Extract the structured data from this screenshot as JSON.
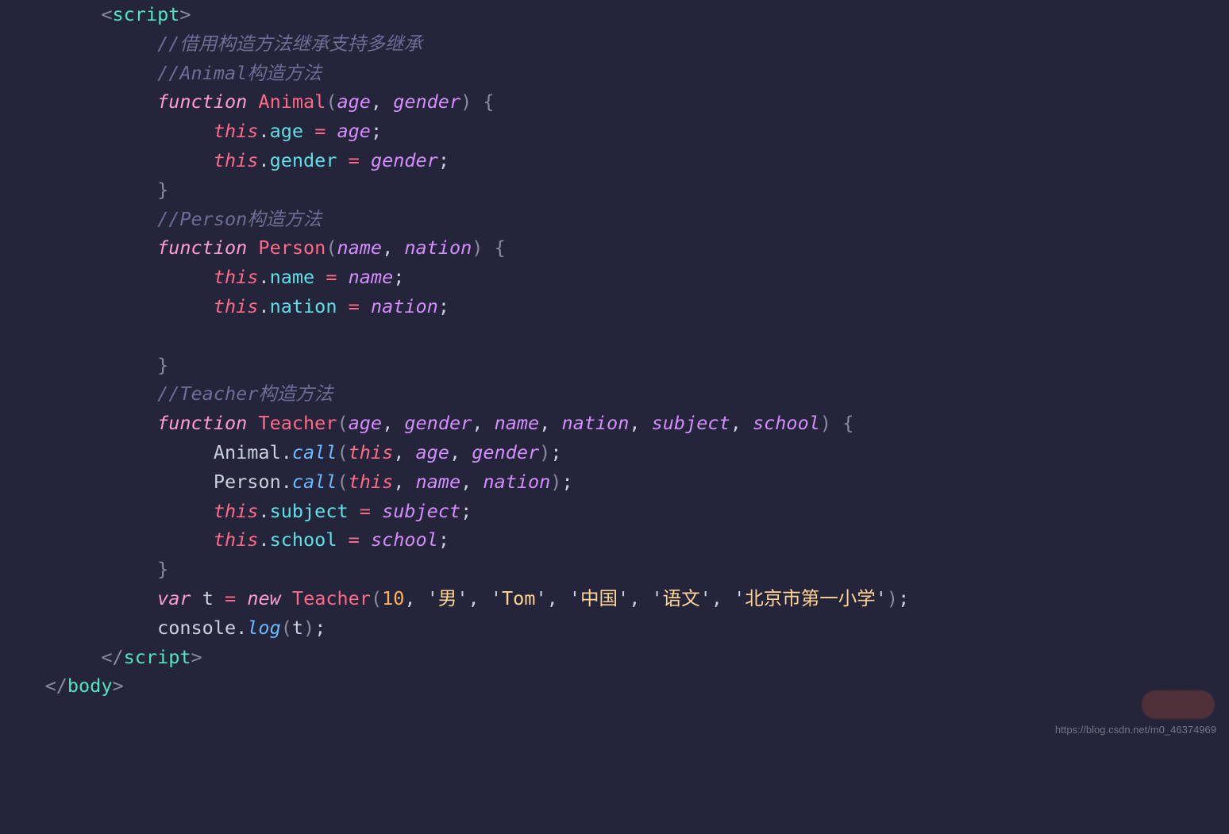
{
  "attribution": "https://blog.csdn.net/m0_46374969",
  "code": {
    "lines": [
      {
        "indent": 2,
        "tokens": [
          {
            "c": "br",
            "t": "<"
          },
          {
            "c": "tag",
            "t": "script"
          },
          {
            "c": "br",
            "t": ">"
          }
        ]
      },
      {
        "indent": 4,
        "tokens": [
          {
            "c": "com",
            "t": "//借用构造方法继承支持多继承"
          }
        ]
      },
      {
        "indent": 4,
        "tokens": [
          {
            "c": "com",
            "t": "//Animal构造方法"
          }
        ]
      },
      {
        "indent": 4,
        "tokens": [
          {
            "c": "kw",
            "t": "function"
          },
          {
            "c": "pun",
            "t": " "
          },
          {
            "c": "def",
            "t": "Animal"
          },
          {
            "c": "br",
            "t": "("
          },
          {
            "c": "par",
            "t": "age"
          },
          {
            "c": "pun",
            "t": ", "
          },
          {
            "c": "par",
            "t": "gender"
          },
          {
            "c": "br",
            "t": ")"
          },
          {
            "c": "pun",
            "t": " "
          },
          {
            "c": "br",
            "t": "{"
          }
        ]
      },
      {
        "indent": 6,
        "tokens": [
          {
            "c": "this",
            "t": "this"
          },
          {
            "c": "pun",
            "t": "."
          },
          {
            "c": "prop",
            "t": "age"
          },
          {
            "c": "pun",
            "t": " "
          },
          {
            "c": "ass",
            "t": "="
          },
          {
            "c": "pun",
            "t": " "
          },
          {
            "c": "par",
            "t": "age"
          },
          {
            "c": "pun",
            "t": ";"
          }
        ]
      },
      {
        "indent": 6,
        "tokens": [
          {
            "c": "this",
            "t": "this"
          },
          {
            "c": "pun",
            "t": "."
          },
          {
            "c": "prop",
            "t": "gender"
          },
          {
            "c": "pun",
            "t": " "
          },
          {
            "c": "ass",
            "t": "="
          },
          {
            "c": "pun",
            "t": " "
          },
          {
            "c": "par",
            "t": "gender"
          },
          {
            "c": "pun",
            "t": ";"
          }
        ]
      },
      {
        "indent": 4,
        "tokens": [
          {
            "c": "br",
            "t": "}"
          }
        ]
      },
      {
        "indent": 4,
        "tokens": [
          {
            "c": "com",
            "t": "//Person构造方法"
          }
        ]
      },
      {
        "indent": 4,
        "tokens": [
          {
            "c": "kw",
            "t": "function"
          },
          {
            "c": "pun",
            "t": " "
          },
          {
            "c": "def",
            "t": "Person"
          },
          {
            "c": "br",
            "t": "("
          },
          {
            "c": "par",
            "t": "name"
          },
          {
            "c": "pun",
            "t": ", "
          },
          {
            "c": "par",
            "t": "nation"
          },
          {
            "c": "br",
            "t": ")"
          },
          {
            "c": "pun",
            "t": " "
          },
          {
            "c": "br",
            "t": "{"
          }
        ]
      },
      {
        "indent": 6,
        "tokens": [
          {
            "c": "this",
            "t": "this"
          },
          {
            "c": "pun",
            "t": "."
          },
          {
            "c": "prop",
            "t": "name"
          },
          {
            "c": "pun",
            "t": " "
          },
          {
            "c": "ass",
            "t": "="
          },
          {
            "c": "pun",
            "t": " "
          },
          {
            "c": "par",
            "t": "name"
          },
          {
            "c": "pun",
            "t": ";"
          }
        ]
      },
      {
        "indent": 6,
        "tokens": [
          {
            "c": "this",
            "t": "this"
          },
          {
            "c": "pun",
            "t": "."
          },
          {
            "c": "prop",
            "t": "nation"
          },
          {
            "c": "pun",
            "t": " "
          },
          {
            "c": "ass",
            "t": "="
          },
          {
            "c": "pun",
            "t": " "
          },
          {
            "c": "par",
            "t": "nation"
          },
          {
            "c": "pun",
            "t": ";"
          }
        ]
      },
      {
        "indent": 6,
        "tokens": [
          {
            "c": "pun",
            "t": ""
          }
        ]
      },
      {
        "indent": 4,
        "tokens": [
          {
            "c": "br",
            "t": "}"
          }
        ]
      },
      {
        "indent": 4,
        "tokens": [
          {
            "c": "com",
            "t": "//Teacher构造方法"
          }
        ]
      },
      {
        "indent": 4,
        "tokens": [
          {
            "c": "kw",
            "t": "function"
          },
          {
            "c": "pun",
            "t": " "
          },
          {
            "c": "def",
            "t": "Teacher"
          },
          {
            "c": "br",
            "t": "("
          },
          {
            "c": "par",
            "t": "age"
          },
          {
            "c": "pun",
            "t": ", "
          },
          {
            "c": "par",
            "t": "gender"
          },
          {
            "c": "pun",
            "t": ", "
          },
          {
            "c": "par",
            "t": "name"
          },
          {
            "c": "pun",
            "t": ", "
          },
          {
            "c": "par",
            "t": "nation"
          },
          {
            "c": "pun",
            "t": ", "
          },
          {
            "c": "par",
            "t": "subject"
          },
          {
            "c": "pun",
            "t": ", "
          },
          {
            "c": "par",
            "t": "school"
          },
          {
            "c": "br",
            "t": ")"
          },
          {
            "c": "pun",
            "t": " "
          },
          {
            "c": "br",
            "t": "{"
          }
        ]
      },
      {
        "indent": 6,
        "tokens": [
          {
            "c": "id",
            "t": "Animal"
          },
          {
            "c": "pun",
            "t": "."
          },
          {
            "c": "call",
            "t": "call"
          },
          {
            "c": "br",
            "t": "("
          },
          {
            "c": "this",
            "t": "this"
          },
          {
            "c": "pun",
            "t": ", "
          },
          {
            "c": "par",
            "t": "age"
          },
          {
            "c": "pun",
            "t": ", "
          },
          {
            "c": "par",
            "t": "gender"
          },
          {
            "c": "br",
            "t": ")"
          },
          {
            "c": "pun",
            "t": ";"
          }
        ]
      },
      {
        "indent": 6,
        "tokens": [
          {
            "c": "id",
            "t": "Person"
          },
          {
            "c": "pun",
            "t": "."
          },
          {
            "c": "call",
            "t": "call"
          },
          {
            "c": "br",
            "t": "("
          },
          {
            "c": "this",
            "t": "this"
          },
          {
            "c": "pun",
            "t": ", "
          },
          {
            "c": "par",
            "t": "name"
          },
          {
            "c": "pun",
            "t": ", "
          },
          {
            "c": "par",
            "t": "nation"
          },
          {
            "c": "br",
            "t": ")"
          },
          {
            "c": "pun",
            "t": ";"
          }
        ]
      },
      {
        "indent": 6,
        "tokens": [
          {
            "c": "this",
            "t": "this"
          },
          {
            "c": "pun",
            "t": "."
          },
          {
            "c": "prop",
            "t": "subject"
          },
          {
            "c": "pun",
            "t": " "
          },
          {
            "c": "ass",
            "t": "="
          },
          {
            "c": "pun",
            "t": " "
          },
          {
            "c": "par",
            "t": "subject"
          },
          {
            "c": "pun",
            "t": ";"
          }
        ]
      },
      {
        "indent": 6,
        "tokens": [
          {
            "c": "this",
            "t": "this"
          },
          {
            "c": "pun",
            "t": "."
          },
          {
            "c": "prop",
            "t": "school"
          },
          {
            "c": "pun",
            "t": " "
          },
          {
            "c": "ass",
            "t": "="
          },
          {
            "c": "pun",
            "t": " "
          },
          {
            "c": "par",
            "t": "school"
          },
          {
            "c": "pun",
            "t": ";"
          }
        ]
      },
      {
        "indent": 4,
        "tokens": [
          {
            "c": "br",
            "t": "}"
          }
        ]
      },
      {
        "indent": 4,
        "tokens": [
          {
            "c": "kw",
            "t": "var"
          },
          {
            "c": "pun",
            "t": " "
          },
          {
            "c": "id",
            "t": "t"
          },
          {
            "c": "pun",
            "t": " "
          },
          {
            "c": "ass",
            "t": "="
          },
          {
            "c": "pun",
            "t": " "
          },
          {
            "c": "kw",
            "t": "new"
          },
          {
            "c": "pun",
            "t": " "
          },
          {
            "c": "def",
            "t": "Teacher"
          },
          {
            "c": "br",
            "t": "("
          },
          {
            "c": "num",
            "t": "10"
          },
          {
            "c": "pun",
            "t": ", "
          },
          {
            "c": "pun",
            "t": "'"
          },
          {
            "c": "str",
            "t": "男"
          },
          {
            "c": "pun",
            "t": "'"
          },
          {
            "c": "pun",
            "t": ", "
          },
          {
            "c": "pun",
            "t": "'"
          },
          {
            "c": "str",
            "t": "Tom"
          },
          {
            "c": "pun",
            "t": "'"
          },
          {
            "c": "pun",
            "t": ", "
          },
          {
            "c": "pun",
            "t": "'"
          },
          {
            "c": "str",
            "t": "中国"
          },
          {
            "c": "pun",
            "t": "'"
          },
          {
            "c": "pun",
            "t": ", "
          },
          {
            "c": "pun",
            "t": "'"
          },
          {
            "c": "str",
            "t": "语文"
          },
          {
            "c": "pun",
            "t": "'"
          },
          {
            "c": "pun",
            "t": ", "
          },
          {
            "c": "pun",
            "t": "'"
          },
          {
            "c": "str",
            "t": "北京市第一小学"
          },
          {
            "c": "pun",
            "t": "'"
          },
          {
            "c": "br",
            "t": ")"
          },
          {
            "c": "pun",
            "t": ";"
          }
        ]
      },
      {
        "indent": 4,
        "tokens": [
          {
            "c": "id",
            "t": "console"
          },
          {
            "c": "pun",
            "t": "."
          },
          {
            "c": "call",
            "t": "log"
          },
          {
            "c": "br",
            "t": "("
          },
          {
            "c": "id",
            "t": "t"
          },
          {
            "c": "br",
            "t": ")"
          },
          {
            "c": "pun",
            "t": ";"
          }
        ]
      },
      {
        "indent": 2,
        "tokens": [
          {
            "c": "br",
            "t": "</"
          },
          {
            "c": "tag",
            "t": "script"
          },
          {
            "c": "br",
            "t": ">"
          }
        ]
      },
      {
        "indent": 0,
        "tokens": [
          {
            "c": "br",
            "t": "</"
          },
          {
            "c": "tag",
            "t": "body"
          },
          {
            "c": "br",
            "t": ">"
          }
        ]
      }
    ]
  }
}
